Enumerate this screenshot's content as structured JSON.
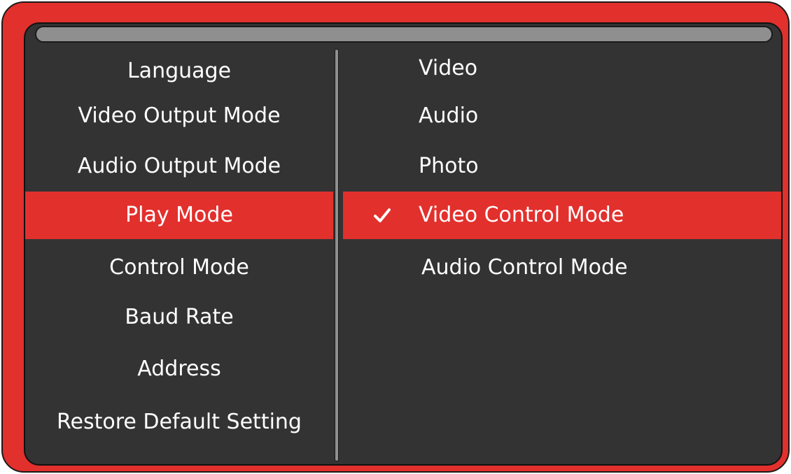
{
  "menu": {
    "left_items": [
      {
        "label": "Language"
      },
      {
        "label": "Video Output Mode"
      },
      {
        "label": "Audio Output Mode"
      },
      {
        "label": "Play Mode",
        "selected": true
      },
      {
        "label": "Control Mode"
      },
      {
        "label": "Baud Rate"
      },
      {
        "label": "Address"
      },
      {
        "label": "Restore Default Setting"
      }
    ],
    "right_items": [
      {
        "label": "Video"
      },
      {
        "label": "Audio"
      },
      {
        "label": "Photo"
      },
      {
        "label": "Video Control Mode",
        "selected": true,
        "icon": "checkmark-icon"
      },
      {
        "label": "Audio Control Mode"
      }
    ]
  },
  "colors": {
    "frame": "#e2302d",
    "screen": "#333333",
    "highlight": "#e2302d",
    "text": "#ffffff",
    "title_bar": "#8f8f8f"
  }
}
